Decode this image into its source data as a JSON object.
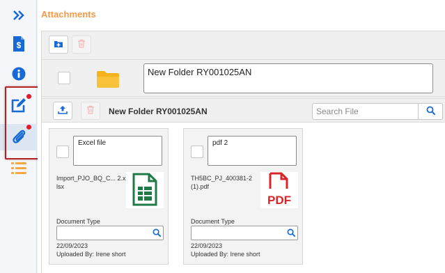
{
  "page": {
    "title": "Attachments"
  },
  "rail": {
    "items": [
      {
        "name": "expand",
        "icon": "double-chevron-right-icon"
      },
      {
        "name": "billing",
        "icon": "dollar-document-icon"
      },
      {
        "name": "info",
        "icon": "info-icon"
      },
      {
        "name": "edit",
        "icon": "edit-icon",
        "badge": true
      },
      {
        "name": "attachments",
        "icon": "paperclip-icon",
        "badge": true,
        "active": true
      },
      {
        "name": "list",
        "icon": "list-icon"
      }
    ]
  },
  "folder": {
    "name": "New Folder RY001025AN"
  },
  "files_header": {
    "title": "New Folder RY001025AN",
    "search_placeholder": "Search File"
  },
  "files": [
    {
      "description": "Excel file",
      "filename": "Import_PJO_BQ_C... 2.xlsx",
      "type_icon": "excel-file-icon",
      "doc_type_label": "Document Type",
      "doc_type_value": "",
      "date": "22/09/2023",
      "uploaded_by": "Uploaded By: Irene short"
    },
    {
      "description": "pdf 2",
      "filename": "TH5BC_PJ_400381-2 (1).pdf",
      "type_icon": "pdf-file-icon",
      "doc_type_label": "Document Type",
      "doc_type_value": "",
      "date": "22/09/2023",
      "uploaded_by": "Uploaded By: Irene short"
    }
  ],
  "colors": {
    "accent_blue": "#1769d6",
    "title_orange": "#f29a4a",
    "badge_red": "#e01a2b",
    "excel_green": "#1f7a45",
    "pdf_red": "#d7262a",
    "folder_yellow": "#f6b21c",
    "list_orange": "#f5a742"
  }
}
